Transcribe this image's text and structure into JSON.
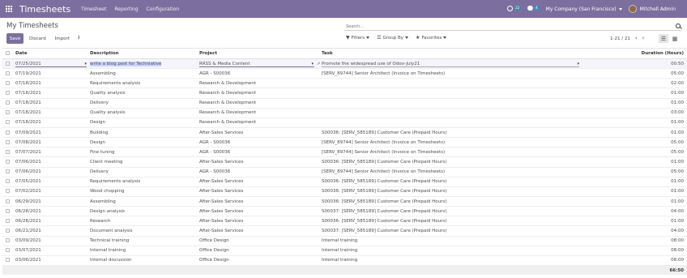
{
  "navbar": {
    "app_title": "Timesheets",
    "menu": [
      "Timesheet",
      "Reporting",
      "Configuration"
    ],
    "activity_count": "22",
    "messages_count": "4",
    "company": "My Company (San Francisco)",
    "user": "Mitchell Admin"
  },
  "control": {
    "breadcrumb": "My Timesheets",
    "search_placeholder": "Search...",
    "buttons": {
      "save": "Save",
      "discard": "Discard",
      "import": "Import"
    },
    "filters": "Filters",
    "group_by": "Group By",
    "favorites": "Favorites",
    "pager": "1-21 / 21"
  },
  "table": {
    "headers": {
      "date": "Date",
      "description": "Description",
      "project": "Project",
      "task": "Task",
      "duration": "Duration (Hours)"
    },
    "editing_row": {
      "date": "07/25/2021",
      "description": "write a blog post for Techniative",
      "project": "RRSS & Media Content",
      "task": "Promote the widespread use of Odoo-July21",
      "duration": "00:50"
    },
    "rows": [
      {
        "date": "07/19/2021",
        "description": "Assembling",
        "project": "AGR - S00036",
        "task": "[SERV_89744] Senior Architect (Invoice on Timesheets)",
        "duration": "05:00"
      },
      {
        "date": "07/18/2021",
        "description": "Requirements analysis",
        "project": "Research & Development",
        "task": "",
        "duration": "02:00"
      },
      {
        "date": "07/18/2021",
        "description": "Quality analysis",
        "project": "Research & Development",
        "task": "",
        "duration": "01:00"
      },
      {
        "date": "07/18/2021",
        "description": "Delivery",
        "project": "Research & Development",
        "task": "",
        "duration": "01:00"
      },
      {
        "date": "07/18/2021",
        "description": "Quality analysis",
        "project": "Research & Development",
        "task": "",
        "duration": "03:00"
      },
      {
        "date": "07/18/2021",
        "description": "Design",
        "project": "Research & Development",
        "task": "",
        "duration": "01:00"
      },
      {
        "date": "07/09/2021",
        "description": "Building",
        "project": "After-Sales Services",
        "task": "S00036: [SERV_585189] Customer Care (Prepaid Hours)",
        "duration": "01:00"
      },
      {
        "date": "07/08/2021",
        "description": "Design",
        "project": "AGR - S00036",
        "task": "[SERV_89744] Senior Architect (Invoice on Timesheets)",
        "duration": "05:00"
      },
      {
        "date": "07/07/2021",
        "description": "Fine tuning",
        "project": "AGR - S00036",
        "task": "[SERV_89744] Senior Architect (Invoice on Timesheets)",
        "duration": "05:00"
      },
      {
        "date": "07/06/2021",
        "description": "Client meeting",
        "project": "After-Sales Services",
        "task": "S00036: [SERV_585189] Customer Care (Prepaid Hours)",
        "duration": "01:00"
      },
      {
        "date": "07/06/2021",
        "description": "Delivery",
        "project": "AGR - S00036",
        "task": "[SERV_89744] Senior Architect (Invoice on Timesheets)",
        "duration": "05:00"
      },
      {
        "date": "07/05/2021",
        "description": "Requirements analysis",
        "project": "After-Sales Services",
        "task": "S00036: [SERV_585189] Customer Care (Prepaid Hours)",
        "duration": "01:00"
      },
      {
        "date": "07/02/2021",
        "description": "Wood chopping",
        "project": "After-Sales Services",
        "task": "S00036: [SERV_585189] Customer Care (Prepaid Hours)",
        "duration": "01:00"
      },
      {
        "date": "06/29/2021",
        "description": "Assembling",
        "project": "After-Sales Services",
        "task": "S00036: [SERV_585189] Customer Care (Prepaid Hours)",
        "duration": "01:00"
      },
      {
        "date": "06/28/2021",
        "description": "Design analysis",
        "project": "After-Sales Services",
        "task": "S00037: [SERV_585189] Customer Care (Prepaid Hours)",
        "duration": "04:00"
      },
      {
        "date": "06/28/2021",
        "description": "Research",
        "project": "After-Sales Services",
        "task": "S00036: [SERV_585189] Customer Care (Prepaid Hours)",
        "duration": "01:00"
      },
      {
        "date": "06/21/2021",
        "description": "Document analysis",
        "project": "After-Sales Services",
        "task": "S00037: [SERV_585189] Customer Care (Prepaid Hours)",
        "duration": "04:00"
      },
      {
        "date": "03/09/2021",
        "description": "Technical training",
        "project": "Office Design",
        "task": "Internal training",
        "duration": "08:00"
      },
      {
        "date": "03/07/2021",
        "description": "Internal training",
        "project": "Office Design",
        "task": "Internal training",
        "duration": "08:00"
      },
      {
        "date": "03/06/2021",
        "description": "Internal discussion",
        "project": "Office Design",
        "task": "Internal training",
        "duration": "08:00"
      }
    ],
    "total": "66:50"
  }
}
